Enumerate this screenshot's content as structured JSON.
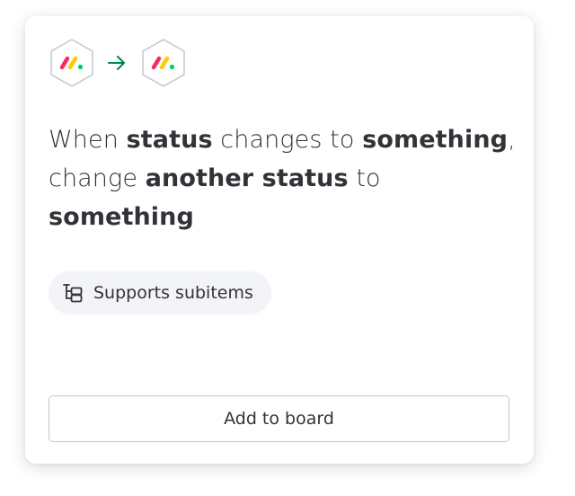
{
  "recipe": {
    "trigger_icon": "monday-logo-icon",
    "connector_icon": "arrow-right-icon",
    "action_icon": "monday-logo-icon",
    "sentence": {
      "part1": "When ",
      "bold1": "status",
      "part2": " changes to ",
      "bold2": "something",
      "part3": ", change ",
      "bold3": "another status",
      "part4": " to ",
      "bold4": "something"
    },
    "chip": {
      "icon": "subitems-icon",
      "label": "Supports subitems"
    },
    "button_label": "Add to board"
  },
  "colors": {
    "text": "#323338",
    "arrow": "#00854d",
    "logo_red": "#fb275d",
    "logo_yellow": "#ffcb00",
    "logo_green": "#00ca72",
    "chip_bg": "#f3f4f8",
    "hex_border": "#c3c6d4"
  }
}
